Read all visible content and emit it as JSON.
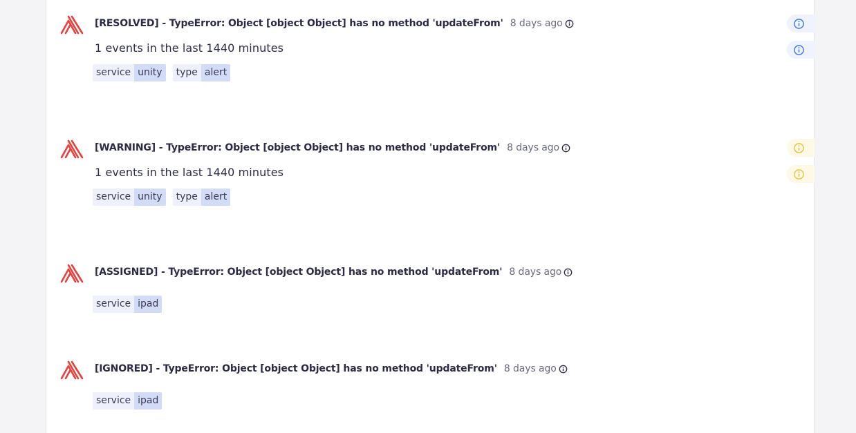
{
  "colors": {
    "logo_red": "#e8403c",
    "badge_blue": "#3c76e6",
    "badge_yellow": "#e9c33a"
  },
  "alerts": [
    {
      "title": "[RESOLVED] - TypeError: Object [object Object] has no method 'updateFrom'",
      "time": "8 days ago",
      "description": "1 events in the last 1440 minutes",
      "tags": [
        {
          "key": "service",
          "value": "unity"
        },
        {
          "key": "type",
          "value": "alert"
        }
      ],
      "badge_color": "blue"
    },
    {
      "title": "[WARNING] - TypeError: Object [object Object] has no method 'updateFrom'",
      "time": "8 days ago",
      "description": "1 events in the last 1440 minutes",
      "tags": [
        {
          "key": "service",
          "value": "unity"
        },
        {
          "key": "type",
          "value": "alert"
        }
      ],
      "badge_color": "yellow"
    },
    {
      "title": "[ASSIGNED] - TypeError: Object [object Object] has no method 'updateFrom'",
      "time": "8 days ago",
      "tags": [
        {
          "key": "service",
          "value": "ipad"
        }
      ]
    },
    {
      "title": "[IGNORED] - TypeError: Object [object Object] has no method 'updateFrom'",
      "time": "8 days ago",
      "tags": [
        {
          "key": "service",
          "value": "ipad"
        }
      ]
    }
  ]
}
